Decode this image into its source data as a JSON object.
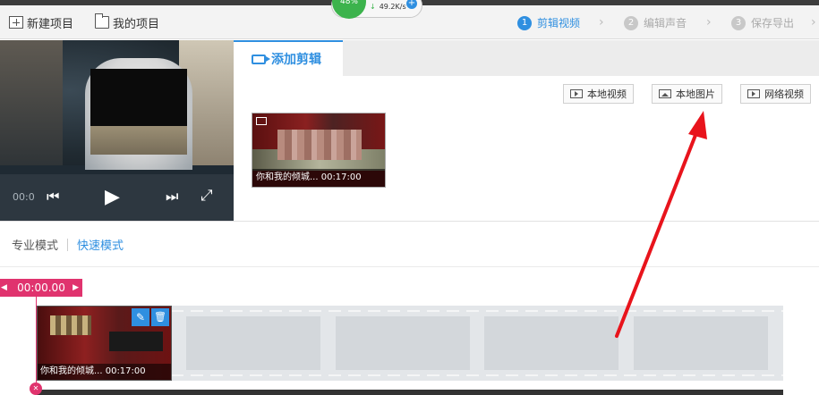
{
  "toolbar": {
    "new_project": "新建项目",
    "my_projects": "我的项目"
  },
  "speed": {
    "percent": "48%",
    "rate": "49.2K/s"
  },
  "steps": [
    {
      "num": "1",
      "label": "剪辑视频",
      "active": true
    },
    {
      "num": "2",
      "label": "编辑声音",
      "active": false
    },
    {
      "num": "3",
      "label": "保存导出",
      "active": false
    }
  ],
  "preview": {
    "time": "00:0"
  },
  "panel": {
    "tab_label": "添加剪辑",
    "buttons": [
      "本地视频",
      "本地图片",
      "网络视频"
    ],
    "clip_caption": "你和我的倾城...  00:17:00"
  },
  "modes": {
    "pro": "专业模式",
    "fast": "快速模式"
  },
  "timeline": {
    "cursor_time": "00:00.00",
    "clip_caption": "你和我的倾城...  00:17:00"
  },
  "colors": {
    "accent": "#2f8fe0",
    "timeline_cursor": "#e0336e",
    "annotation_arrow": "#e8141c"
  }
}
